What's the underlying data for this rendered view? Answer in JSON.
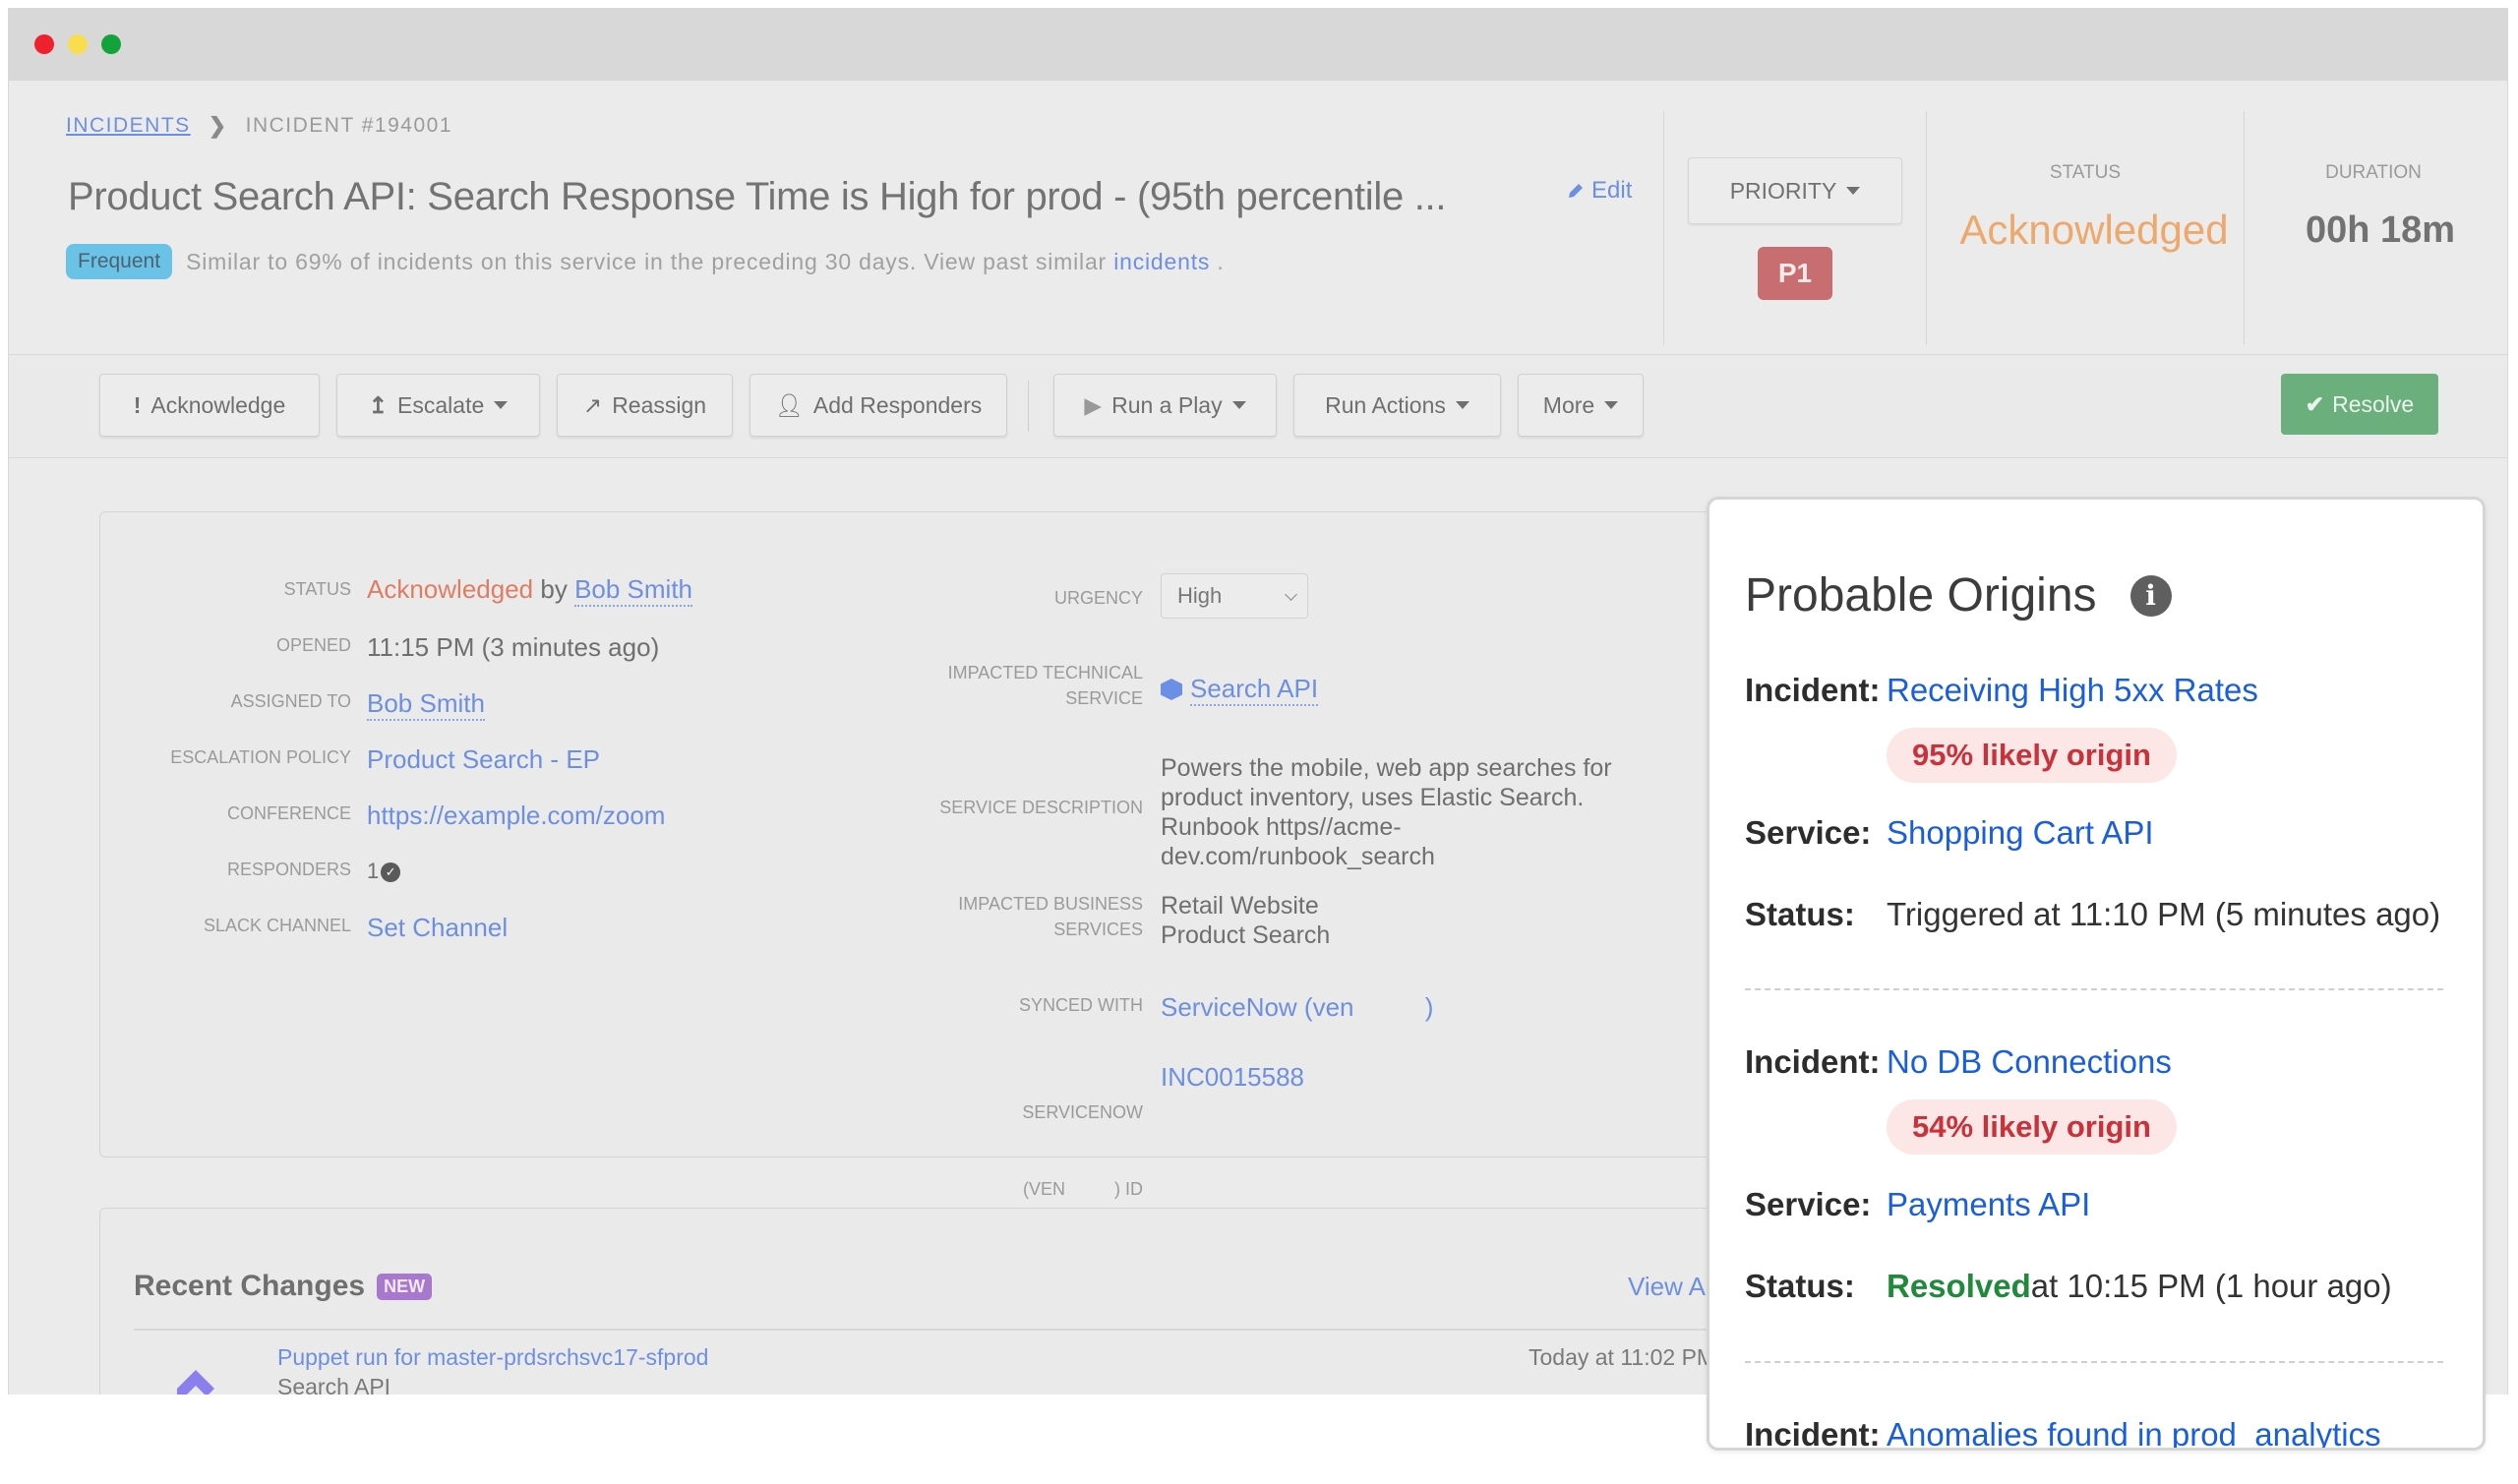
{
  "window": {
    "traffic_lights": [
      "close",
      "minimize",
      "maximize"
    ]
  },
  "breadcrumb": {
    "parent": "INCIDENTS",
    "separator_icon": "chevron-right-icon",
    "current": "INCIDENT #194001"
  },
  "incident": {
    "title": "Product Search API: Search Response Time is High for prod - (95th percentile ...",
    "edit_label": "Edit",
    "frequent_badge": "Frequent",
    "frequent_text": "Similar to 69% of incidents on this service in the preceding 30 days. View past similar",
    "frequent_link": "incidents",
    "frequent_suffix": "."
  },
  "header_stats": {
    "priority_label": "PRIORITY",
    "priority_value": "P1",
    "status_label": "STATUS",
    "status_value": "Acknowledged",
    "duration_label": "DURATION",
    "duration_value": "00h 18m"
  },
  "toolbar": {
    "acknowledge": "Acknowledge",
    "escalate": "Escalate",
    "reassign": "Reassign",
    "add_responders": "Add Responders",
    "run_a_play": "Run a Play",
    "run_actions": "Run Actions",
    "more": "More",
    "resolve": "Resolve"
  },
  "details": {
    "status_label": "STATUS",
    "status_value": "Acknowledged",
    "status_by": "by",
    "status_user": "Bob Smith",
    "opened_label": "OPENED",
    "opened_value": "11:15 PM (3 minutes ago)",
    "assigned_label": "ASSIGNED TO",
    "assigned_value": "Bob Smith",
    "escalation_label": "ESCALATION POLICY",
    "escalation_value": "Product Search - EP",
    "conference_label": "CONFERENCE",
    "conference_value": "https://example.com/zoom",
    "responders_label": "RESPONDERS",
    "responders_value": "1",
    "slack_label": "SLACK CHANNEL",
    "slack_value": "Set Channel",
    "urgency_label": "URGENCY",
    "urgency_value": "High",
    "tech_service_label_1": "IMPACTED TECHNICAL",
    "tech_service_label_2": "SERVICE",
    "tech_service_value": "Search API",
    "service_desc_label": "SERVICE DESCRIPTION",
    "service_desc_lines": [
      "Powers the mobile, web app searches for",
      "product inventory, uses Elastic Search.",
      "Runbook https//acme-",
      "dev.com/runbook_search"
    ],
    "business_label_1": "IMPACTED BUSINESS",
    "business_label_2": "SERVICES",
    "business_values": [
      "Retail Website",
      "Product Search"
    ],
    "synced_label": "SYNCED WITH",
    "synced_value": "ServiceNow (ven          )",
    "sn_id_label_1": "SERVICENOW",
    "sn_id_label_2": "(VEN          ) ID",
    "sn_id_value": "INC0015588"
  },
  "recent_changes": {
    "title": "Recent Changes",
    "new_badge": "NEW",
    "view_all": "View A",
    "items": [
      {
        "title": "Puppet run for master-prdsrchsvc17-sfprod",
        "service": "Search API",
        "time": "Today at 11:02 PM"
      }
    ]
  },
  "probable_origins": {
    "title": "Probable Origins",
    "incident_key": "Incident:",
    "service_key": "Service:",
    "status_key": "Status:",
    "items": [
      {
        "incident": "Receiving High 5xx Rates",
        "likelihood": "95% likely origin",
        "service": "Shopping Cart API",
        "status_prefix": "",
        "status_text": "Triggered at 11:10 PM (5 minutes ago)"
      },
      {
        "incident": "No DB Connections",
        "likelihood": "54% likely origin",
        "service": "Payments API",
        "status_prefix": "Resolved",
        "status_text": "at 10:15 PM (1 hour ago)"
      },
      {
        "incident": "Anomalies found in prod_analytics"
      }
    ]
  },
  "colors": {
    "link": "#6d8fe0",
    "acknowledged_header": "#eda86c",
    "acknowledged_detail": "#df7d63",
    "priority_p1": "#c86e71",
    "resolve_button": "#6baf7d",
    "frequent_badge": "#6ac2e6",
    "new_badge": "#a878cf",
    "likely_origin_text": "#c8323a",
    "resolved_text": "#1e8a3a",
    "popup_link": "#1a5ee0"
  }
}
